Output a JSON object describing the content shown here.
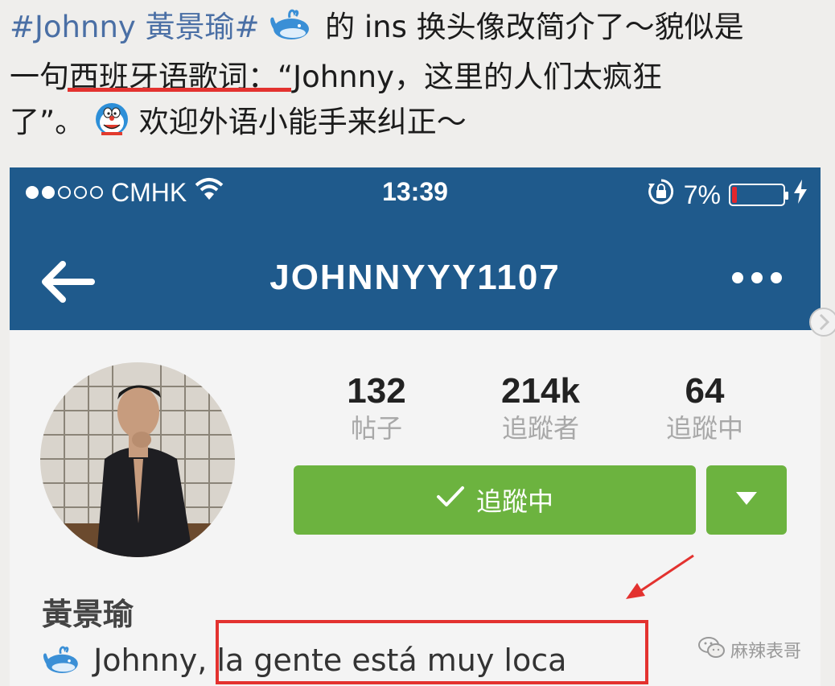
{
  "post": {
    "hashtag": "#Johnny 黃景瑜#",
    "line1_rest": "的 ins 换头像改简介了～貌似是",
    "line2_prefix": "一句",
    "line2_underlined": "西班牙语歌词",
    "line2_rest": "：“Johnny，这里的人们太疯狂",
    "line3_start": "了”。",
    "line3_rest": "欢迎外语小能手来纠正～"
  },
  "status_bar": {
    "carrier": "CMHK",
    "time": "13:39",
    "battery_percent": "7%",
    "battery_level": 0.07
  },
  "nav": {
    "title": "JOHNNYYY1107"
  },
  "stats": [
    {
      "value": "132",
      "label": "帖子"
    },
    {
      "value": "214k",
      "label": "追蹤者"
    },
    {
      "value": "64",
      "label": "追蹤中"
    }
  ],
  "follow_button": {
    "label": "追蹤中"
  },
  "profile": {
    "name": "黃景瑜",
    "bio_prefix": "Johnny, ",
    "bio_highlight": "la gente está muy loca"
  },
  "watermark": {
    "text": "麻辣表哥"
  },
  "colors": {
    "nav_bg": "#1f5a8c",
    "follow_green": "#6cb33f",
    "annotation_red": "#e3322f",
    "hashtag_blue": "#4a6fa5"
  },
  "icons": [
    "whale-icon",
    "doraemon-icon",
    "wifi-icon",
    "orientation-lock-icon",
    "charging-icon",
    "back-arrow-icon",
    "more-icon",
    "check-icon",
    "caret-down-icon",
    "wechat-icon"
  ]
}
